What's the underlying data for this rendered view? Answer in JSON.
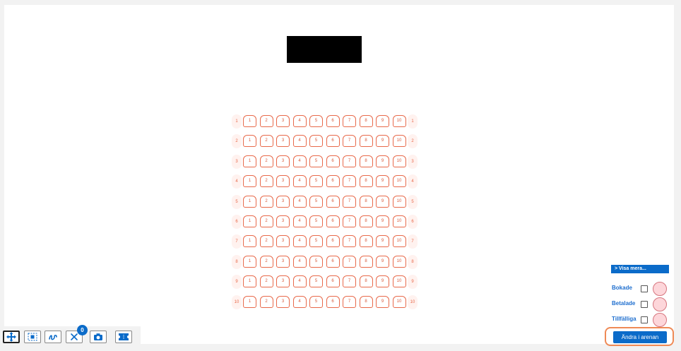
{
  "stage": {
    "label": ""
  },
  "rows": [
    {
      "label": "1",
      "seats": [
        "1",
        "2",
        "3",
        "4",
        "5",
        "6",
        "7",
        "8",
        "9",
        "10"
      ]
    },
    {
      "label": "2",
      "seats": [
        "1",
        "2",
        "3",
        "4",
        "5",
        "6",
        "7",
        "8",
        "9",
        "10"
      ]
    },
    {
      "label": "3",
      "seats": [
        "1",
        "2",
        "3",
        "4",
        "5",
        "6",
        "7",
        "8",
        "9",
        "10"
      ]
    },
    {
      "label": "4",
      "seats": [
        "1",
        "2",
        "3",
        "4",
        "5",
        "6",
        "7",
        "8",
        "9",
        "10"
      ]
    },
    {
      "label": "5",
      "seats": [
        "1",
        "2",
        "3",
        "4",
        "5",
        "6",
        "7",
        "8",
        "9",
        "10"
      ]
    },
    {
      "label": "6",
      "seats": [
        "1",
        "2",
        "3",
        "4",
        "5",
        "6",
        "7",
        "8",
        "9",
        "10"
      ]
    },
    {
      "label": "7",
      "seats": [
        "1",
        "2",
        "3",
        "4",
        "5",
        "6",
        "7",
        "8",
        "9",
        "10"
      ]
    },
    {
      "label": "8",
      "seats": [
        "1",
        "2",
        "3",
        "4",
        "5",
        "6",
        "7",
        "8",
        "9",
        "10"
      ]
    },
    {
      "label": "9",
      "seats": [
        "1",
        "2",
        "3",
        "4",
        "5",
        "6",
        "7",
        "8",
        "9",
        "10"
      ]
    },
    {
      "label": "10",
      "seats": [
        "1",
        "2",
        "3",
        "4",
        "5",
        "6",
        "7",
        "8",
        "9",
        "10"
      ]
    }
  ],
  "legend": {
    "visa_mera": "> Visa mera...",
    "items": [
      {
        "label": "Bokade",
        "checked": false
      },
      {
        "label": "Betalade",
        "checked": false
      },
      {
        "label": "Tillfälliga",
        "checked": false
      }
    ]
  },
  "arena_button": "Ändra i arenan",
  "toolbar": {
    "selected_count": "0",
    "tools": [
      "move-icon",
      "select-area-icon",
      "draw-icon",
      "clear-icon",
      "camera-icon",
      "ticket-icon"
    ]
  },
  "colors": {
    "seat_outline": "#e8694a",
    "accent_blue": "#0b6bc9",
    "legend_dot": "#fdd6da",
    "highlight_border": "#ef8a56"
  }
}
